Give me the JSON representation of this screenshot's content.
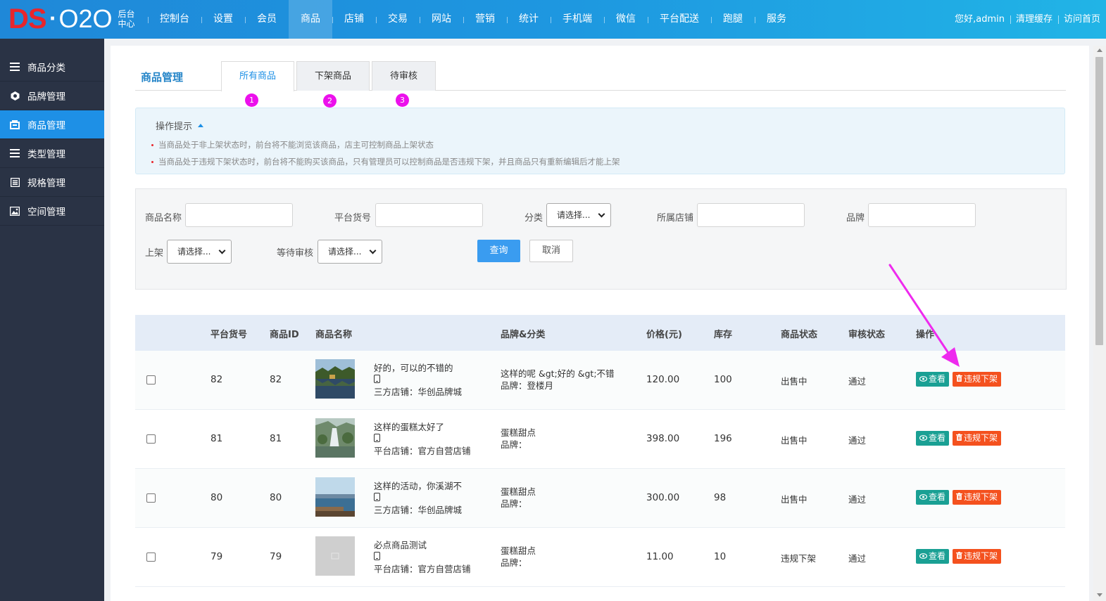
{
  "logo": {
    "ds": "DS",
    "o2o": "O2O",
    "sub_line1": "后台",
    "sub_line2": "中心"
  },
  "topnav": [
    "控制台",
    "设置",
    "会员",
    "商品",
    "店铺",
    "交易",
    "网站",
    "营销",
    "统计",
    "手机端",
    "微信",
    "平台配送",
    "跑腿",
    "服务"
  ],
  "topnav_active": "商品",
  "topright": {
    "greeting": "您好,admin",
    "clear_cache": "清理缓存",
    "visit_home": "访问首页"
  },
  "sidebar": {
    "items": [
      {
        "label": "商品分类",
        "icon": "list-icon"
      },
      {
        "label": "品牌管理",
        "icon": "brand-icon"
      },
      {
        "label": "商品管理",
        "icon": "bag-icon"
      },
      {
        "label": "类型管理",
        "icon": "list-icon"
      },
      {
        "label": "规格管理",
        "icon": "spec-icon"
      },
      {
        "label": "空间管理",
        "icon": "image-icon"
      }
    ],
    "active": "商品管理"
  },
  "page": {
    "heading": "商品管理",
    "tabs": [
      "所有商品",
      "下架商品",
      "待审核"
    ],
    "tab_badges": [
      "1",
      "2",
      "3"
    ],
    "active_tab": "所有商品"
  },
  "tips": {
    "title": "操作提示",
    "lines": [
      "当商品处于非上架状态时，前台将不能浏览该商品，店主可控制商品上架状态",
      "当商品处于违规下架状态时，前台将不能购买该商品，只有管理员可以控制商品是否违规下架，并且商品只有重新编辑后才能上架"
    ]
  },
  "search": {
    "name_label": "商品名称",
    "sku_label": "平台货号",
    "category_label": "分类",
    "category_value": "请选择...",
    "store_label": "所属店铺",
    "brand_label": "品牌",
    "shelf_label": "上架",
    "shelf_value": "请选择...",
    "audit_label": "等待审核",
    "audit_value": "请选择...",
    "query_button": "查询",
    "cancel_button": "取消"
  },
  "table": {
    "headers": [
      "平台货号",
      "商品ID",
      "商品名称",
      "品牌&分类",
      "价格(元)",
      "库存",
      "商品状态",
      "审核状态",
      "操作"
    ],
    "view_label": "查看",
    "off_label": "违规下架",
    "rows": [
      {
        "sku": "82",
        "id": "82",
        "name": "好的，可以的不错的",
        "store": "三方店铺：华创品牌城",
        "category": "这样的呢 &gt;好的 &gt;不错",
        "brand": "品牌：登楼月",
        "price": "120.00",
        "stock": "100",
        "status": "出售中",
        "audit": "通过",
        "thumb": "lake"
      },
      {
        "sku": "81",
        "id": "81",
        "name": "这样的蛋糕太好了",
        "store": "平台店铺：官方自营店铺",
        "category": "蛋糕甜点",
        "brand": "品牌：",
        "price": "398.00",
        "stock": "196",
        "status": "出售中",
        "audit": "通过",
        "thumb": "waterfall"
      },
      {
        "sku": "80",
        "id": "80",
        "name": "这样的活动，你溪湖不",
        "store": "三方店铺：华创品牌城",
        "category": "蛋糕甜点",
        "brand": "品牌：",
        "price": "300.00",
        "stock": "98",
        "status": "出售中",
        "audit": "通过",
        "thumb": "pier"
      },
      {
        "sku": "79",
        "id": "79",
        "name": "必点商品测试",
        "store": "平台店铺：官方自营店铺",
        "category": "蛋糕甜点",
        "brand": "品牌：",
        "price": "11.00",
        "stock": "10",
        "status": "违规下架",
        "audit": "通过",
        "thumb": "placeholder"
      }
    ]
  },
  "colors": {
    "accent": "#1e90e6",
    "badge": "#ec10ec",
    "arrow": "#ee2aee",
    "view_btn": "#1aa094",
    "off_btn": "#f4511e"
  }
}
